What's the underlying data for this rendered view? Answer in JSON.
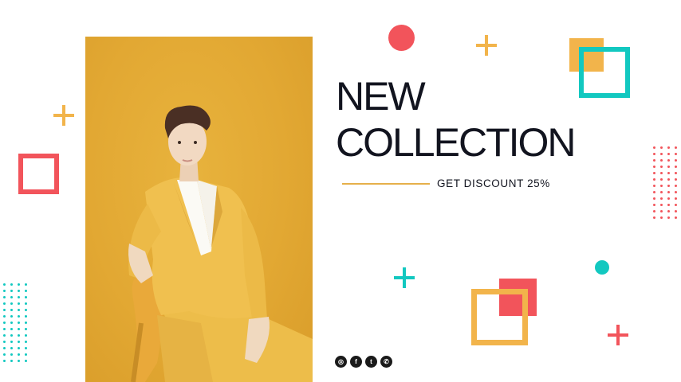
{
  "headline": {
    "line1": "NEW",
    "line2": "COLLECTION"
  },
  "offer": {
    "text": "GET DISCOUNT 25%"
  },
  "social": [
    {
      "name": "instagram-icon",
      "glyph": "◎"
    },
    {
      "name": "facebook-icon",
      "glyph": "f"
    },
    {
      "name": "twitter-icon",
      "glyph": "t"
    },
    {
      "name": "whatsapp-icon",
      "glyph": "✆"
    }
  ],
  "colors": {
    "accent_yellow": "#f2b44b",
    "accent_red": "#f2545b",
    "accent_teal": "#12c8c0",
    "text_dark": "#12141f"
  }
}
